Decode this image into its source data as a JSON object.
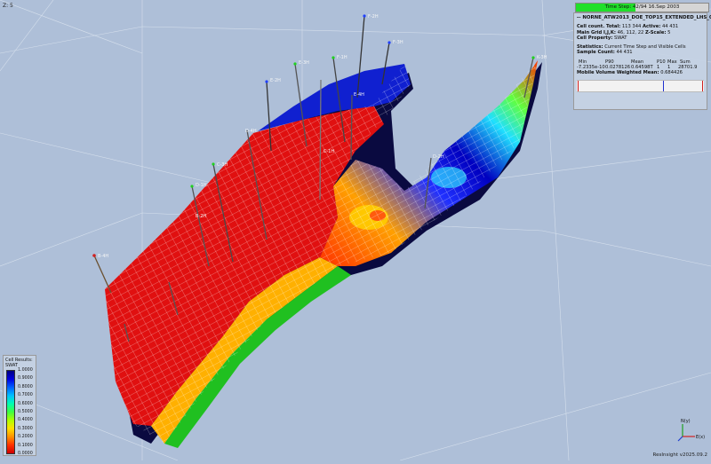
{
  "viewer": {
    "z_scale_label": "Z: 5",
    "time_step_label": "Time Step: 42/94 16.Sep 2003",
    "time_step_progress": 0.45,
    "version": "ResInsight v2025.09.2"
  },
  "info": {
    "case_title": "-- NORNE_ATW2013_DOE_TOP15_EXTENDED_LHS_0001 --",
    "cell_count_label": "Cell count. Total:",
    "cell_count_total": "113 344",
    "active_label": "Active:",
    "active_count": "44 431",
    "main_grid_label": "Main Grid I,J,K:",
    "main_grid_value": "46, 112, 22",
    "zscale_label": "Z-Scale:",
    "zscale_value": "5",
    "cell_property_label": "Cell Property:",
    "cell_property_value": "SWAT",
    "statistics_label": "Statistics:",
    "statistics_value": "Current Time Step and Visible Cells",
    "sample_count_label": "Sample Count:",
    "sample_count_value": "44 431",
    "stats_headers": [
      "Min",
      "P90",
      "Mean",
      "P10",
      "Max",
      "Sum"
    ],
    "stats_values": [
      "-7.2335e-10",
      "0.0278126",
      "0.64598T",
      "1",
      "1",
      "28701.9"
    ],
    "mobile_volume_label": "Mobile Volume Weighted Mean:",
    "mobile_volume_value": "0.684426"
  },
  "legend": {
    "title_line1": "Cell Results:",
    "title_line2": "SWAT",
    "ticks": [
      "1.0000",
      "0.9000",
      "0.8000",
      "0.7000",
      "0.6000",
      "0.5000",
      "0.4000",
      "0.3000",
      "0.2000",
      "0.1000",
      "0.0000"
    ]
  },
  "axes": {
    "x": "E(x)",
    "y": "N(y)",
    "z": "Z"
  },
  "colors": {
    "background": "#aebfd8",
    "swat_low": "#d00000",
    "swat_high": "#000080",
    "timestep_fill": "#20e02a"
  }
}
